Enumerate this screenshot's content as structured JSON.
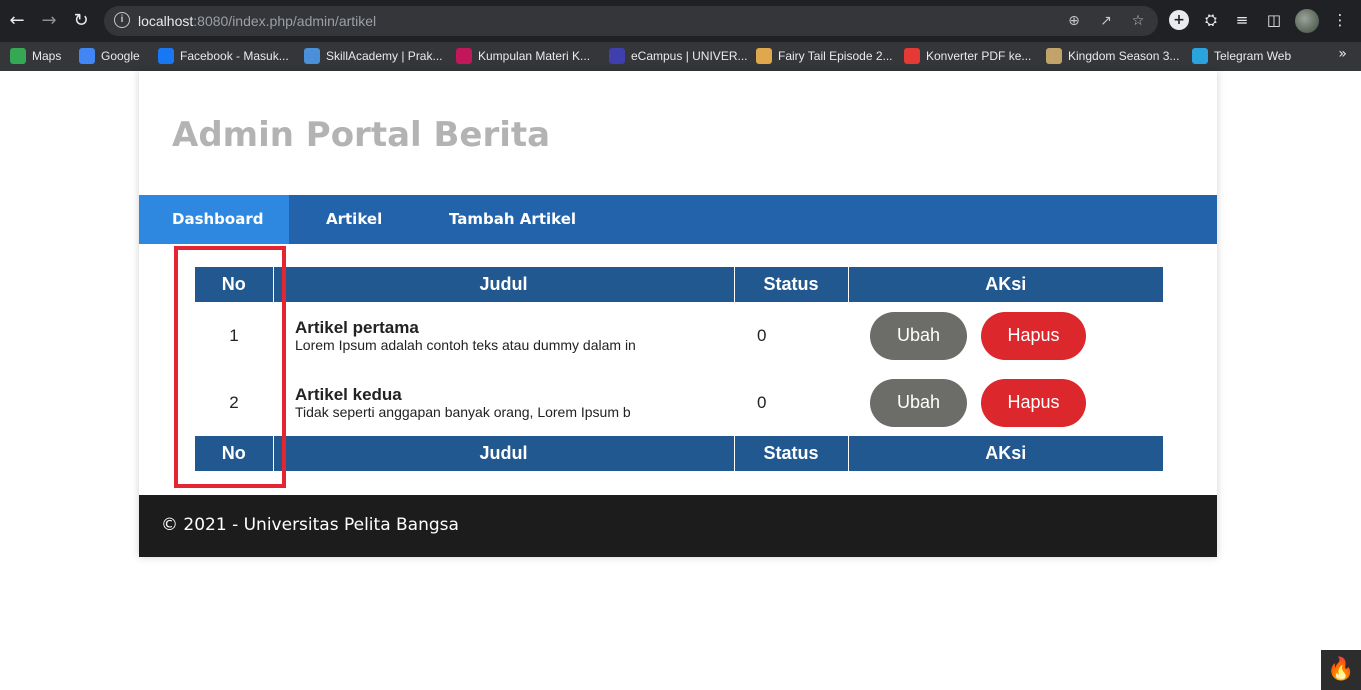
{
  "browser": {
    "url_host": "localhost",
    "url_rest": ":8080/index.php/admin/artikel",
    "bookmarks": [
      {
        "label": "Maps",
        "icon": "maps-icon",
        "color": "#34a853"
      },
      {
        "label": "Google",
        "icon": "google-icon",
        "color": "#4285f4"
      },
      {
        "label": "Facebook - Masuk...",
        "icon": "facebook-icon",
        "color": "#1877f2"
      },
      {
        "label": "SkillAcademy | Prak...",
        "icon": "skillacademy-icon",
        "color": "#4a90d9"
      },
      {
        "label": "Kumpulan Materi K...",
        "icon": "materi-icon",
        "color": "#c2185b"
      },
      {
        "label": "eCampus | UNIVER...",
        "icon": "ecampus-icon",
        "color": "#3f3fae"
      },
      {
        "label": "Fairy Tail Episode 2...",
        "icon": "fairytail-icon",
        "color": "#e0a84c"
      },
      {
        "label": "Konverter PDF ke...",
        "icon": "pdf-icon",
        "color": "#e53935"
      },
      {
        "label": "Kingdom Season 3...",
        "icon": "kingdom-icon",
        "color": "#c2a46a"
      },
      {
        "label": "Telegram Web",
        "icon": "telegram-icon",
        "color": "#2aa3df"
      }
    ],
    "more_label": "»"
  },
  "site": {
    "title": "Admin Portal Berita"
  },
  "nav": {
    "items": [
      {
        "label": "Dashboard",
        "active": true
      },
      {
        "label": "Artikel",
        "active": false
      },
      {
        "label": "Tambah Artikel",
        "active": false
      }
    ]
  },
  "table": {
    "headers": {
      "no": "No",
      "judul": "Judul",
      "status": "Status",
      "aksi": "AKsi"
    },
    "rows": [
      {
        "no": "1",
        "title": "Artikel pertama",
        "excerpt": "Lorem Ipsum adalah contoh teks atau dummy dalam in",
        "status": "0",
        "edit_label": "Ubah",
        "delete_label": "Hapus"
      },
      {
        "no": "2",
        "title": "Artikel kedua",
        "excerpt": "Tidak seperti anggapan banyak orang, Lorem Ipsum b",
        "status": "0",
        "edit_label": "Ubah",
        "delete_label": "Hapus"
      }
    ]
  },
  "footer": {
    "text": "© 2021 - Universitas Pelita Bangsa"
  },
  "colors": {
    "nav_bg": "#2263ab",
    "nav_active": "#2e88e0",
    "table_header": "#215890",
    "btn_ubah": "#6c6c69",
    "btn_hapus": "#dc272c",
    "highlight": "#e32631",
    "footer_bg": "#1c1c1c"
  }
}
